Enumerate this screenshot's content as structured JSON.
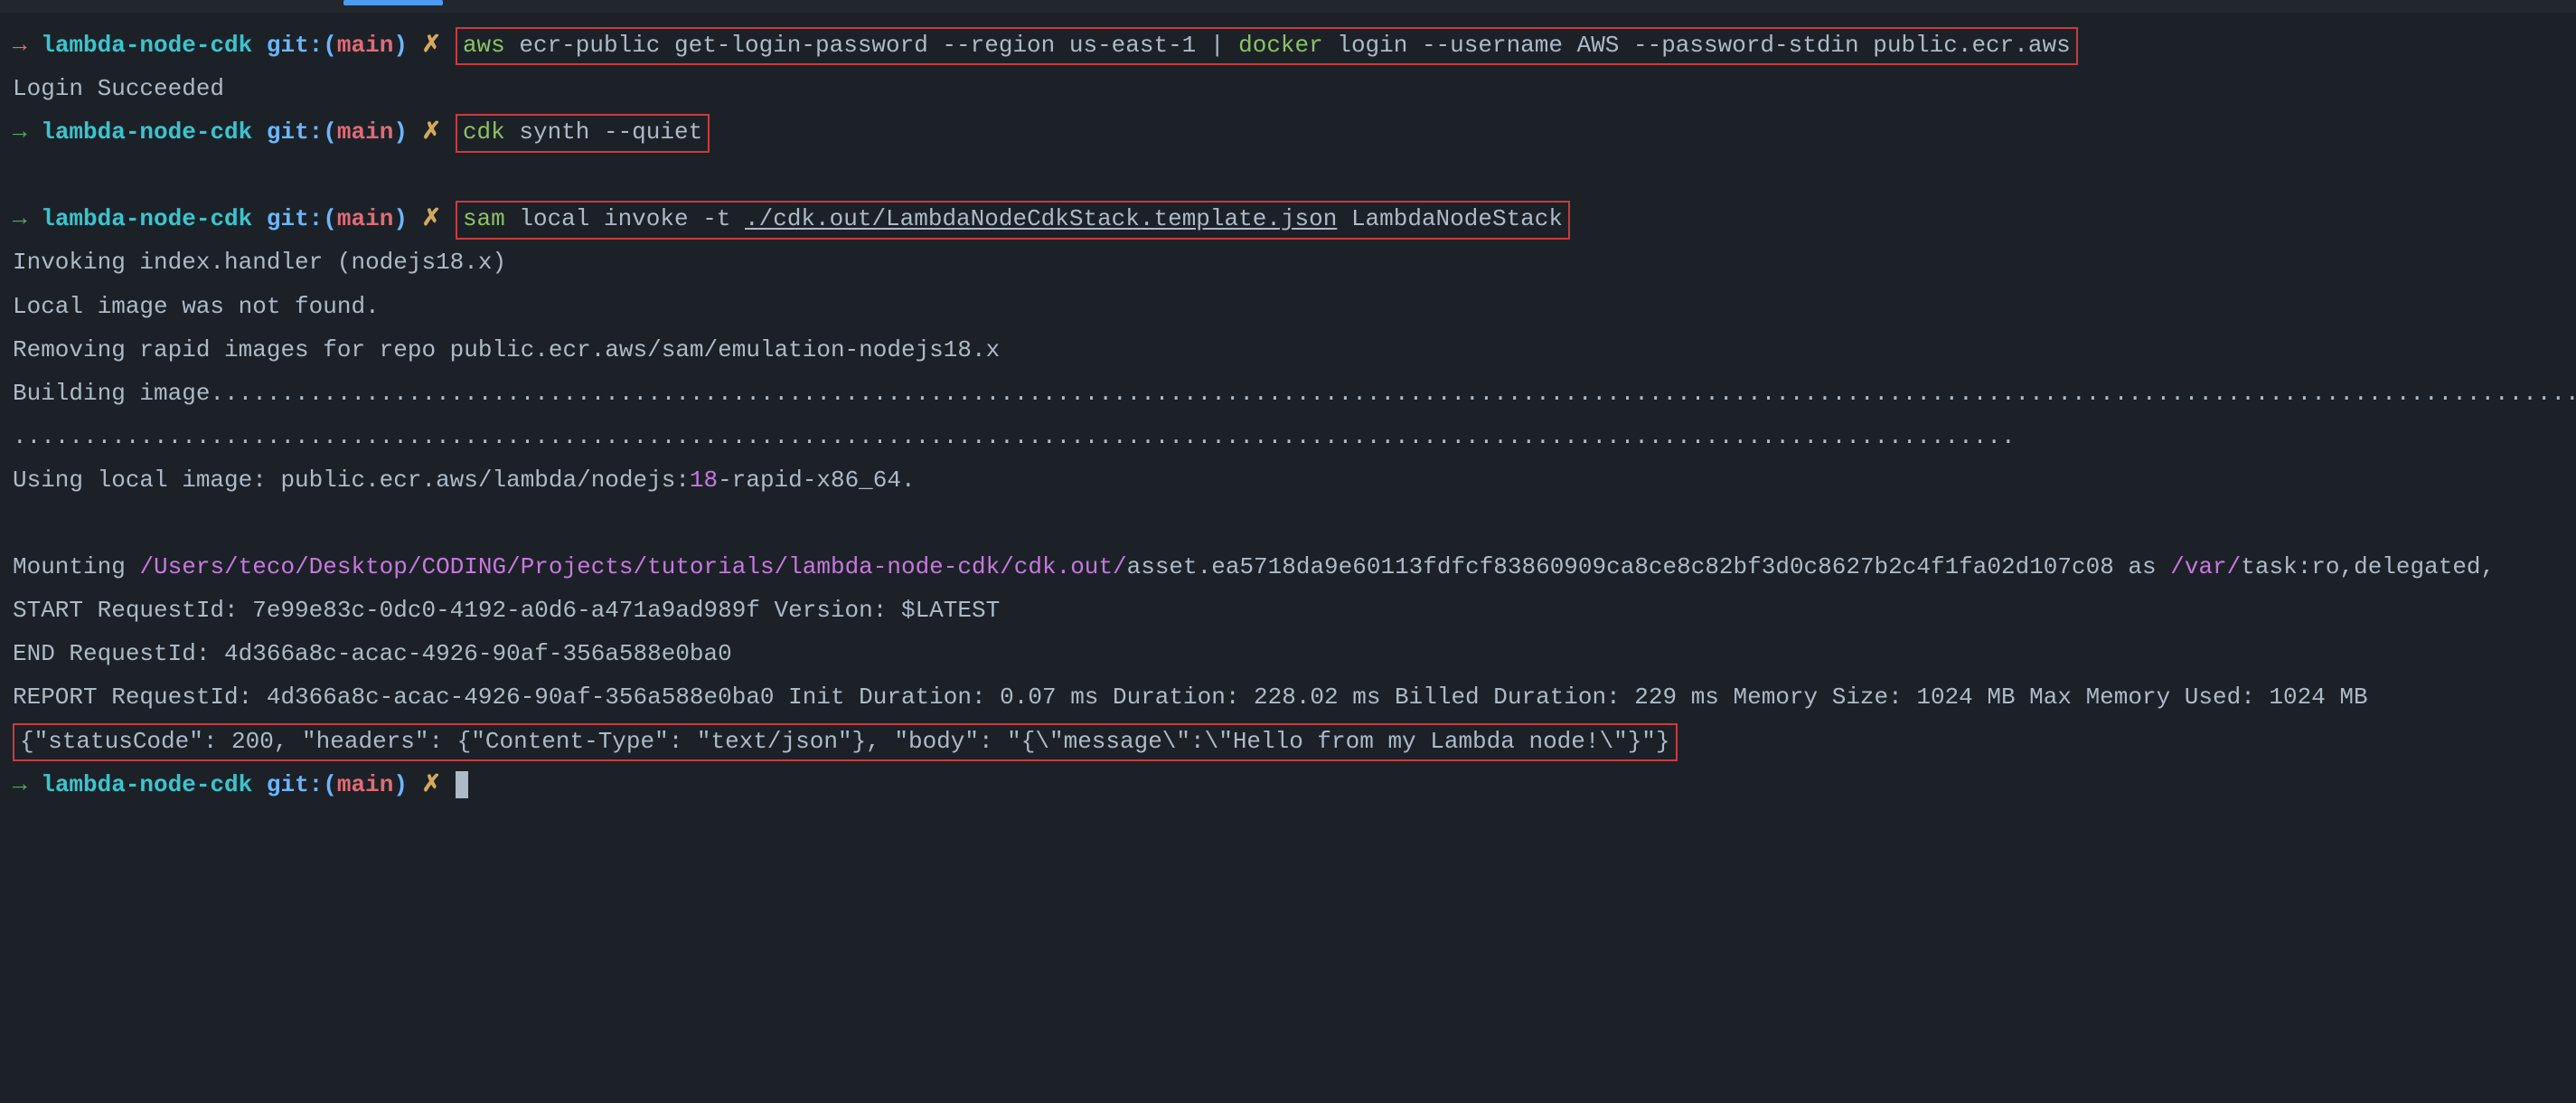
{
  "prompts": {
    "arrow": "→",
    "folder": "lambda-node-cdk",
    "git_label": "git:(",
    "branch": "main",
    "git_close": ")",
    "x": "✗"
  },
  "cmd1": {
    "aws": "aws",
    "rest1": "ecr-public get-login-password --region us-east-1 |",
    "docker": "docker",
    "rest2": "login --username AWS --password-stdin public.ecr.aws"
  },
  "out1": "Login Succeeded",
  "cmd2": {
    "cdk": "cdk",
    "rest": "synth --quiet"
  },
  "cmd3": {
    "sam": "sam",
    "mid": "local invoke -t",
    "path": "./cdk.out/LambdaNodeCdkStack.template.json",
    "tail": "LambdaNodeStack"
  },
  "out_invoke1": "Invoking index.handler (nodejs18.x)",
  "out_invoke2": "Local image was not found.",
  "out_invoke3": "Removing rapid images for repo public.ecr.aws/sam/emulation-nodejs18.x",
  "out_build": "Building image..................................................................................................................................................................................",
  "out_dots": "..............................................................................................................................................",
  "out_local_image_a": "Using local image: public.ecr.aws/lambda/nodejs:",
  "out_local_image_b": "18",
  "out_local_image_c": "-rapid-x86_64.",
  "mount": {
    "label": "Mounting",
    "path1": "/Users/teco/Desktop/CODING/Projects/tutorials/lambda-node-cdk/cdk.out/",
    "asset": "asset.ea5718da9e60113fdfcf83860909ca8ce8c82bf3d0c8627b2c4f1fa02d107c08",
    "as": "as",
    "var": "/var/",
    "task": "task",
    "tail": ":ro,delegated, "
  },
  "start": "START RequestId: 7e99e83c-0dc0-4192-a0d6-a471a9ad989f Version: $LATEST",
  "end": "END RequestId: 4d366a8c-acac-4926-90af-356a588e0ba0",
  "report": "REPORT RequestId: 4d366a8c-acac-4926-90af-356a588e0ba0  Init Duration: 0.07 ms  Duration: 228.02 ms     Billed Duration: 229 ms Memory Size: 1024 MB    Max Memory Used: 1024 MB",
  "json_out": "{\"statusCode\": 200, \"headers\": {\"Content-Type\": \"text/json\"}, \"body\": \"{\\\"message\\\":\\\"Hello from my Lambda node!\\\"}\"}"
}
